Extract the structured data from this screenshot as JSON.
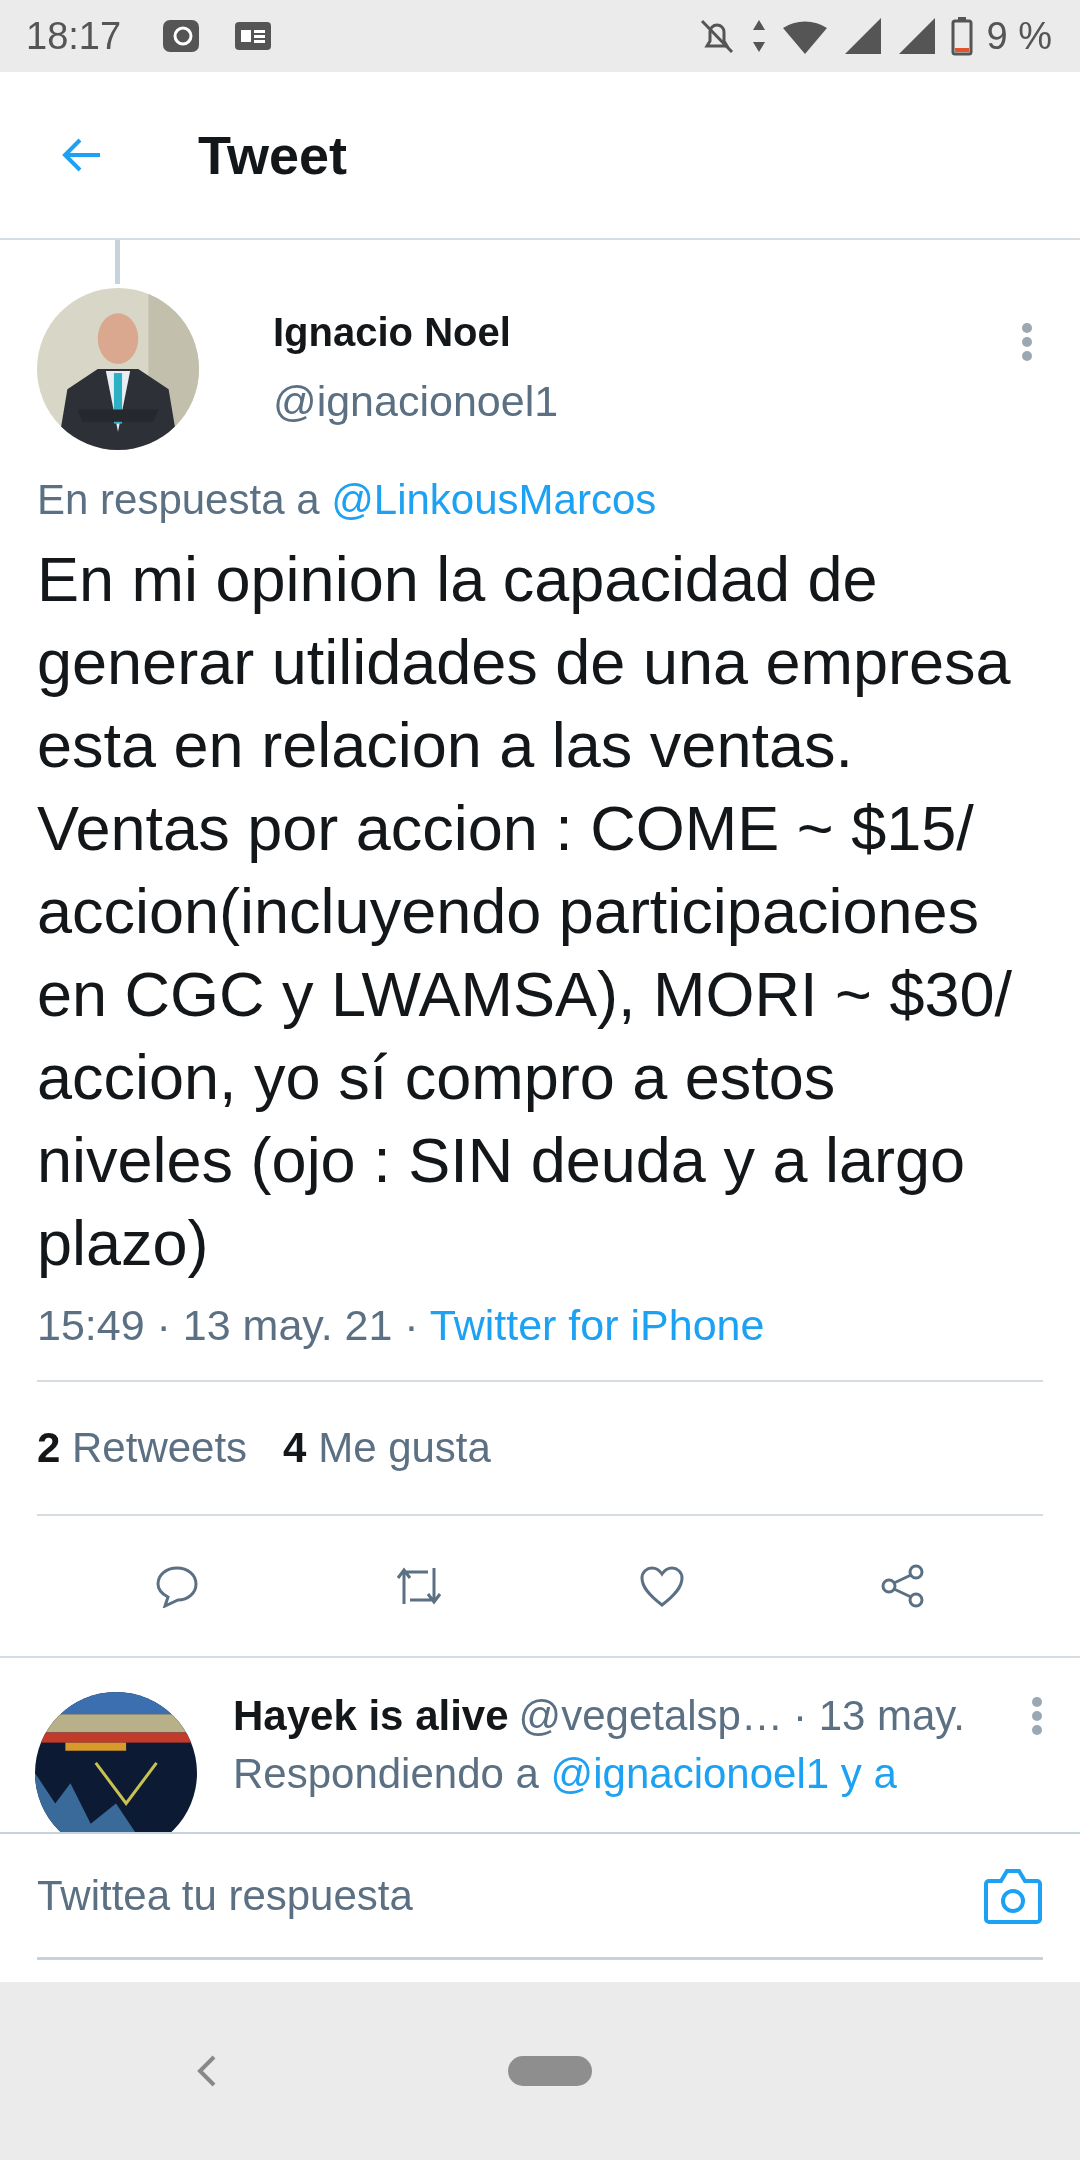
{
  "status_bar": {
    "time": "18:17",
    "battery": "9 %"
  },
  "header": {
    "title": "Tweet"
  },
  "tweet": {
    "name": "Ignacio Noel",
    "handle": "@ignacionoel1",
    "reply_prefix": "En respuesta a",
    "reply_to": "@LinkousMarcos",
    "text": "En mi opinion la capacidad de generar utilidades de una empresa esta en relacion a las ventas. Ventas por accion : COME ~ $15/ accion(incluyendo participaciones en CGC y LWAMSA), MORI ~ $30/ accion, yo sí compro a estos niveles (ojo : SIN deuda y a largo plazo)",
    "timestamp": "15:49 · 13 may. 21 ·",
    "source": "Twitter for iPhone"
  },
  "stats": [
    {
      "count": "2",
      "label": "Retweets"
    },
    {
      "count": "4",
      "label": "Me gusta"
    }
  ],
  "actions": [
    {
      "kind": "reply"
    },
    {
      "kind": "retweet"
    },
    {
      "kind": "like"
    },
    {
      "kind": "share"
    }
  ],
  "replies": [
    {
      "name": "Hayek is alive",
      "handle": "@vegetalsp…",
      "time": "· 13 may.",
      "prefix": "Respondiendo a",
      "mentions": "@ignacionoel1 y a"
    }
  ],
  "composer": {
    "placeholder": "Twittea tu respuesta"
  }
}
